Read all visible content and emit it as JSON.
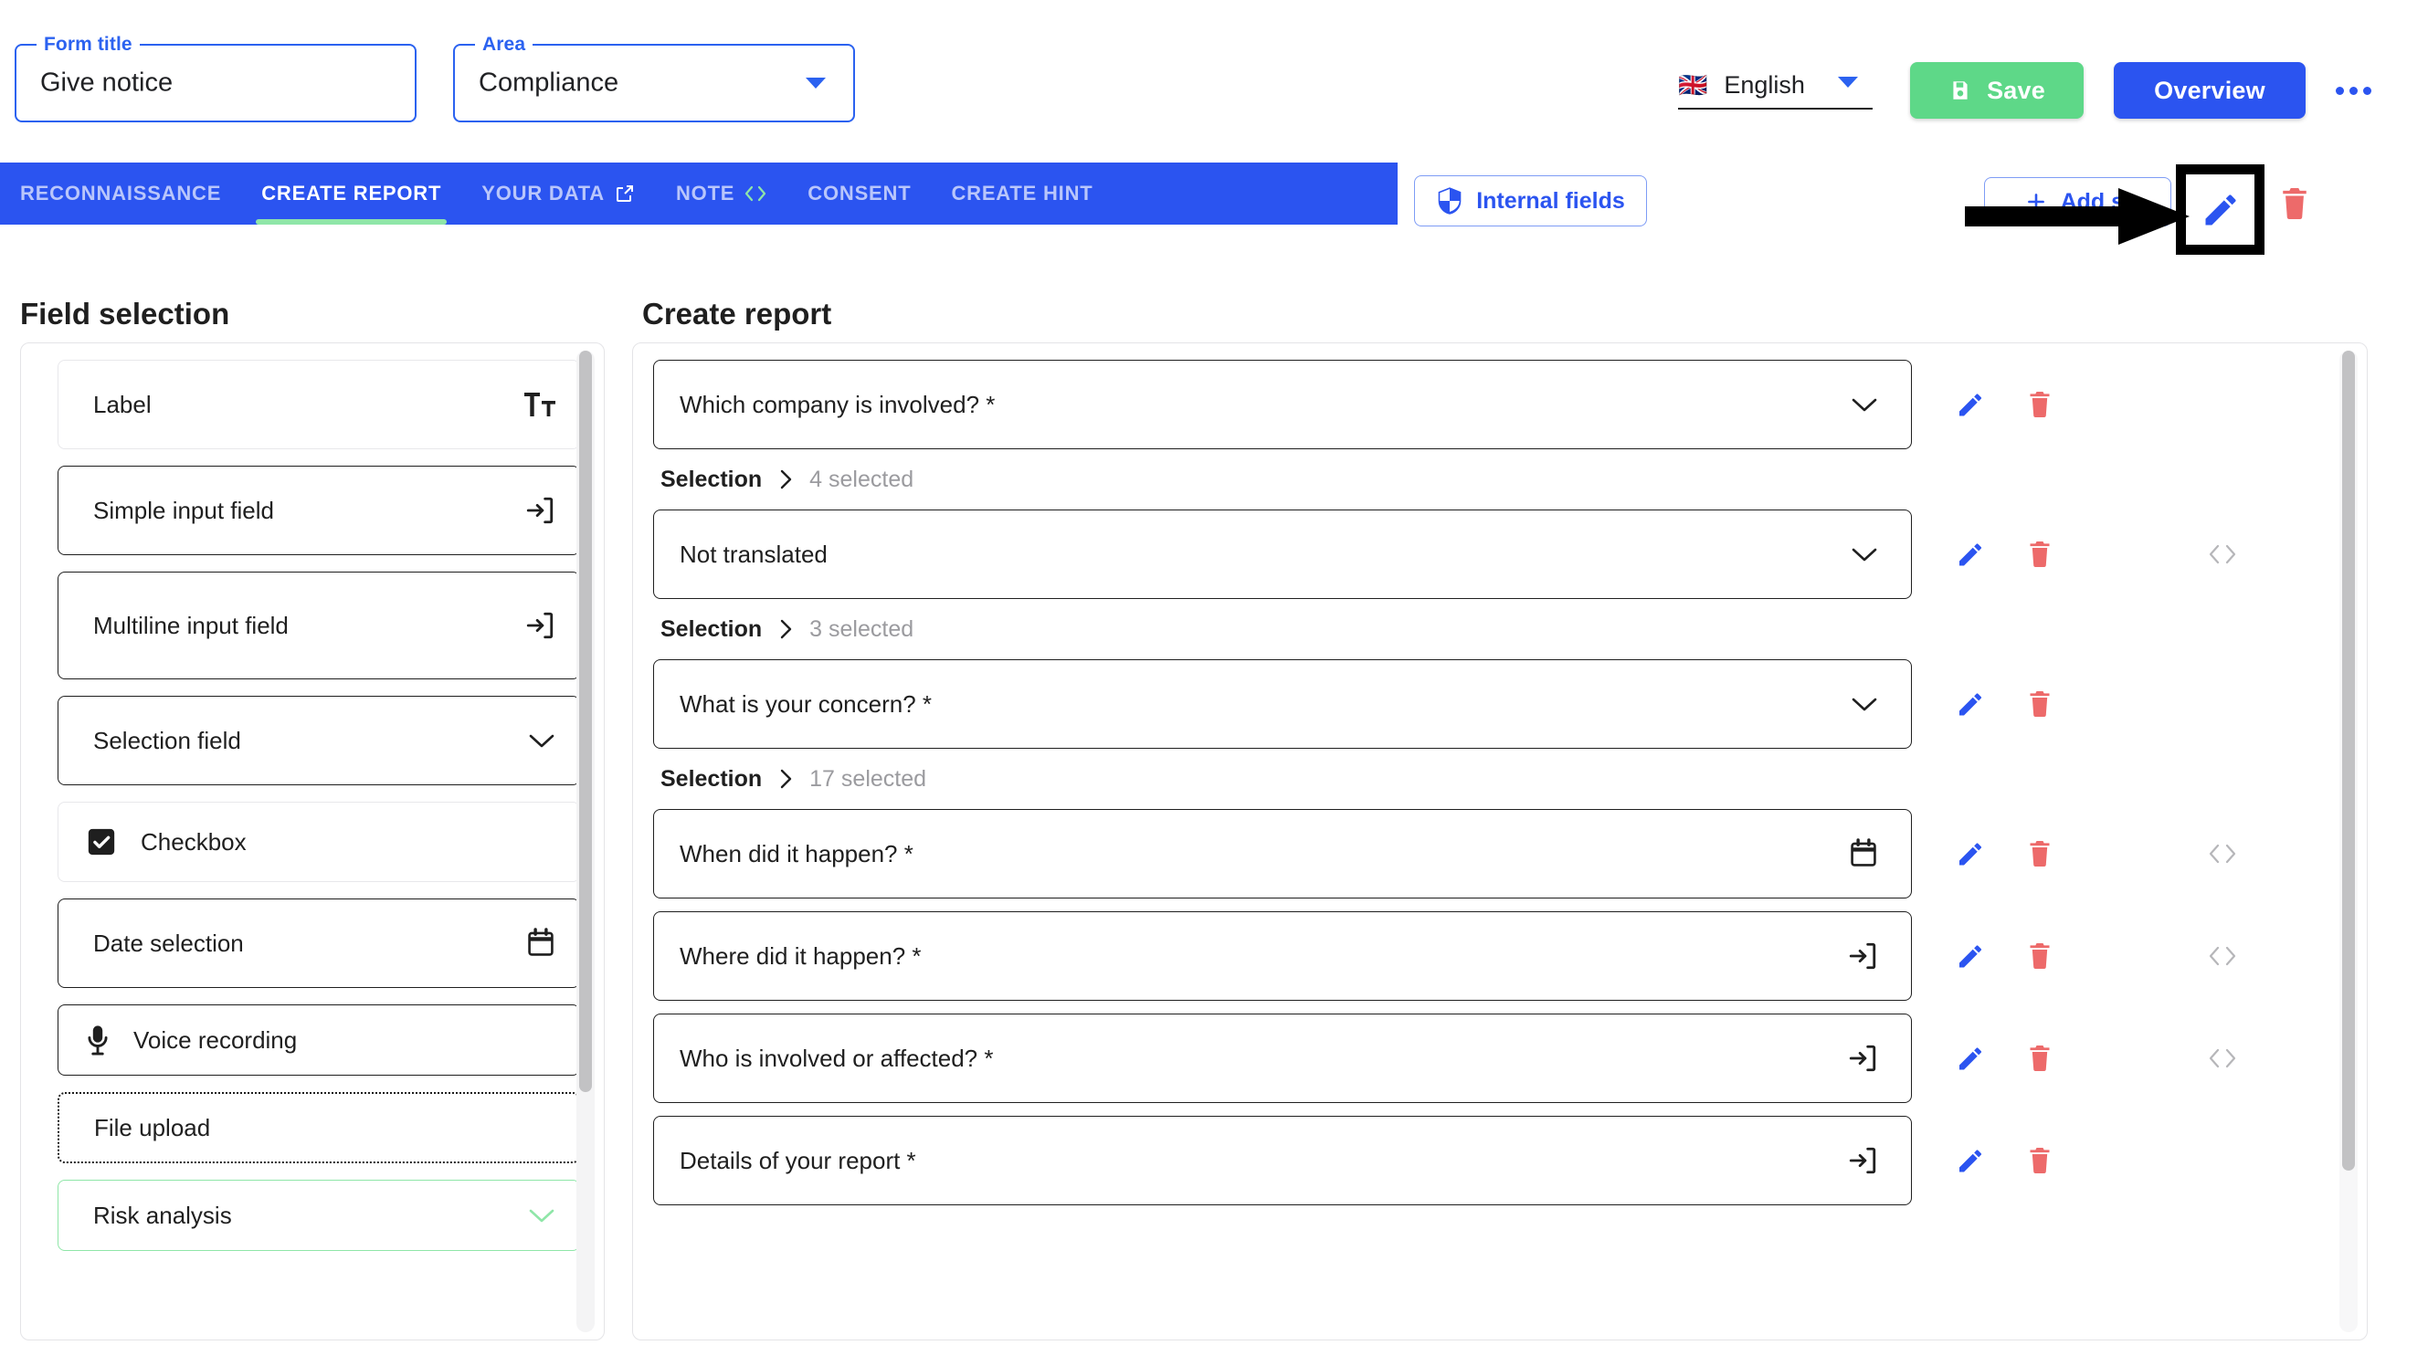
{
  "header": {
    "form_title": {
      "legend": "Form title",
      "value": "Give notice"
    },
    "area": {
      "legend": "Area",
      "value": "Compliance"
    },
    "language": {
      "flag": "uk-flag-icon",
      "label": "English"
    },
    "save_label": "Save",
    "overview_label": "Overview",
    "more_menu": "more-options",
    "colors": {
      "primary": "#2b54f0",
      "save": "#5ed888",
      "accent_green": "#8fe6a8",
      "danger": "#ed6a6a"
    }
  },
  "tabs": [
    {
      "label": "RECONNAISSANCE",
      "active": false,
      "icon": null
    },
    {
      "label": "CREATE REPORT",
      "active": true,
      "icon": null
    },
    {
      "label": "YOUR DATA",
      "active": false,
      "icon": "external-link-icon"
    },
    {
      "label": "NOTE",
      "active": false,
      "icon": "code-icon"
    },
    {
      "label": "CONSENT",
      "active": false,
      "icon": null
    },
    {
      "label": "CREATE HINT",
      "active": false,
      "icon": null
    }
  ],
  "toolbar": {
    "internal_fields_label": "Internal fields",
    "internal_fields_icon": "shield-icon",
    "add_step_label": "Add st",
    "add_step_icon": "plus-icon",
    "edit_label": "edit-step",
    "delete_label": "delete-step",
    "annotation": "black-arrow-pointing-to-edit-button"
  },
  "left_panel": {
    "heading": "Field selection",
    "items": [
      {
        "label": "Label",
        "icon": "text-format-icon",
        "icon_side": "right",
        "style": "soft"
      },
      {
        "label": "Simple input field",
        "icon": "input-field-icon",
        "icon_side": "right",
        "style": "solid"
      },
      {
        "label": "Multiline input field",
        "icon": "input-field-icon",
        "icon_side": "right",
        "style": "solid"
      },
      {
        "label": "Selection field",
        "icon": "chevron-down-icon",
        "icon_side": "right",
        "style": "solid"
      },
      {
        "label": "Checkbox",
        "icon": "checkbox-checked-icon",
        "icon_side": "left",
        "style": "soft"
      },
      {
        "label": "Date selection",
        "icon": "calendar-icon",
        "icon_side": "right",
        "style": "solid"
      },
      {
        "label": "Voice recording",
        "icon": "microphone-icon",
        "icon_side": "left",
        "style": "solid"
      },
      {
        "label": "File upload",
        "icon": null,
        "icon_side": "right",
        "style": "dashed"
      },
      {
        "label": "Risk analysis",
        "icon": "chevron-down-icon",
        "icon_side": "right",
        "style": "risk"
      }
    ]
  },
  "main_panel": {
    "heading": "Create report",
    "rows": [
      {
        "label": "Which company is involved? *",
        "icon": "chevron-down-icon",
        "has_code": false,
        "note": {
          "label": "Selection",
          "count": "4 selected"
        }
      },
      {
        "label": "Not translated",
        "icon": "chevron-down-icon",
        "has_code": true,
        "note": {
          "label": "Selection",
          "count": "3 selected"
        }
      },
      {
        "label": "What is your concern? *",
        "icon": "chevron-down-icon",
        "has_code": false,
        "note": {
          "label": "Selection",
          "count": "17 selected"
        }
      },
      {
        "label": "When did it happen? *",
        "icon": "calendar-icon",
        "has_code": true,
        "note": null
      },
      {
        "label": "Where did it happen? *",
        "icon": "input-field-icon",
        "has_code": true,
        "note": null
      },
      {
        "label": "Who is involved or affected? *",
        "icon": "input-field-icon",
        "has_code": true,
        "note": null
      },
      {
        "label": "Details of your report *",
        "icon": "input-field-icon",
        "has_code": false,
        "note": null
      }
    ],
    "row_actions": {
      "edit": "edit-field",
      "delete": "delete-field",
      "code": "view-code"
    }
  }
}
